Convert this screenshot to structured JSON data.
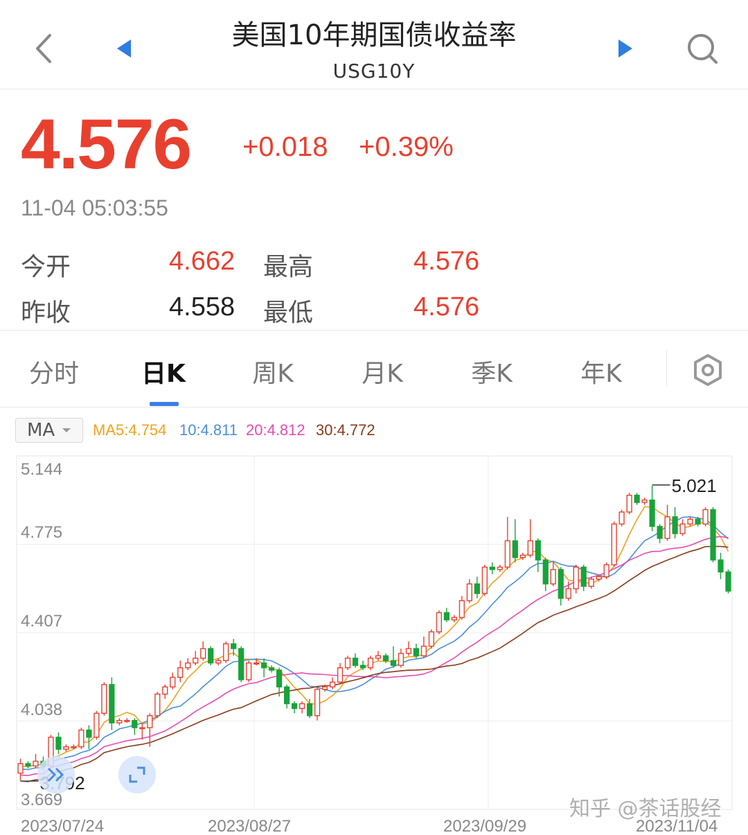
{
  "header": {
    "title": "美国10年期国债收益率",
    "symbol": "USG10Y"
  },
  "quote": {
    "price": "4.576",
    "change": "+0.018",
    "change_pct": "+0.39%",
    "timestamp": "11-04 05:03:55",
    "open_label": "今开",
    "open_value": "4.662",
    "high_label": "最高",
    "high_value": "4.576",
    "prev_close_label": "昨收",
    "prev_close_value": "4.558",
    "low_label": "最低",
    "low_value": "4.576"
  },
  "tabs": [
    {
      "label": "分时",
      "active": false
    },
    {
      "label": "日K",
      "active": true
    },
    {
      "label": "周K",
      "active": false
    },
    {
      "label": "月K",
      "active": false
    },
    {
      "label": "季K",
      "active": false
    },
    {
      "label": "年K",
      "active": false
    }
  ],
  "indicator": {
    "select_label": "MA",
    "ma5": "MA5:4.754",
    "ma10": "10:4.811",
    "ma20": "20:4.812",
    "ma30": "30:4.772"
  },
  "colors": {
    "up": "#e8402f",
    "down": "#19a33a",
    "ma5": "#f0a21c",
    "ma10": "#4a8fd8",
    "ma20": "#e64bb3",
    "ma30": "#8a3a1a"
  },
  "icons": {
    "back": "chevron-left-icon",
    "prev": "triangle-left-icon",
    "next": "triangle-right-icon",
    "search": "search-icon",
    "settings": "hexagon-settings-icon",
    "expand_left": "double-chevron-icon",
    "fullscreen": "fullscreen-icon"
  },
  "watermark": "知乎 @茶话股经",
  "chart_data": {
    "type": "candlestick",
    "y_ticks": [
      "5.144",
      "4.775",
      "4.407",
      "4.038",
      "3.669"
    ],
    "ylim": [
      3.669,
      5.144
    ],
    "x_labels": [
      "2023/07/24",
      "2023/08/27",
      "2023/09/29",
      "2023/11/04"
    ],
    "max_label": "5.021",
    "min_label": "3.792",
    "grid": true,
    "candles": [
      [
        3.82,
        3.86,
        3.79,
        3.88
      ],
      [
        3.86,
        3.85,
        3.84,
        3.87
      ],
      [
        3.85,
        3.87,
        3.84,
        3.9
      ],
      [
        3.87,
        3.85,
        3.83,
        3.89
      ],
      [
        3.85,
        3.97,
        3.84,
        3.98
      ],
      [
        3.97,
        3.92,
        3.9,
        3.99
      ],
      [
        3.92,
        3.93,
        3.91,
        3.94
      ],
      [
        3.93,
        3.93,
        3.92,
        3.94
      ],
      [
        3.93,
        4.0,
        3.92,
        4.01
      ],
      [
        4.0,
        3.97,
        3.92,
        4.02
      ],
      [
        3.97,
        4.07,
        3.96,
        4.08
      ],
      [
        4.07,
        4.19,
        4.06,
        4.2
      ],
      [
        4.19,
        4.03,
        4.0,
        4.22
      ],
      [
        4.03,
        4.04,
        4.02,
        4.05
      ],
      [
        4.04,
        4.04,
        4.03,
        4.05
      ],
      [
        4.04,
        4.01,
        3.98,
        4.05
      ],
      [
        4.01,
        4.01,
        3.96,
        4.03
      ],
      [
        4.01,
        4.06,
        3.93,
        4.07
      ],
      [
        4.06,
        4.15,
        4.05,
        4.16
      ],
      [
        4.15,
        4.18,
        4.13,
        4.19
      ],
      [
        4.18,
        4.22,
        4.17,
        4.24
      ],
      [
        4.22,
        4.26,
        4.2,
        4.29
      ],
      [
        4.26,
        4.28,
        4.25,
        4.3
      ],
      [
        4.28,
        4.3,
        4.27,
        4.33
      ],
      [
        4.3,
        4.34,
        4.29,
        4.37
      ],
      [
        4.34,
        4.28,
        4.27,
        4.35
      ],
      [
        4.28,
        4.29,
        4.27,
        4.3
      ],
      [
        4.29,
        4.36,
        4.28,
        4.37
      ],
      [
        4.36,
        4.34,
        4.31,
        4.38
      ],
      [
        4.34,
        4.21,
        4.2,
        4.35
      ],
      [
        4.21,
        4.28,
        4.2,
        4.29
      ],
      [
        4.28,
        4.28,
        4.27,
        4.3
      ],
      [
        4.28,
        4.26,
        4.22,
        4.3
      ],
      [
        4.26,
        4.25,
        4.24,
        4.27
      ],
      [
        4.25,
        4.18,
        4.14,
        4.26
      ],
      [
        4.18,
        4.11,
        4.09,
        4.19
      ],
      [
        4.11,
        4.09,
        4.07,
        4.12
      ],
      [
        4.09,
        4.11,
        4.07,
        4.12
      ],
      [
        4.11,
        4.06,
        4.05,
        4.13
      ],
      [
        4.06,
        4.17,
        4.04,
        4.18
      ],
      [
        4.17,
        4.18,
        4.16,
        4.19
      ],
      [
        4.18,
        4.2,
        4.17,
        4.22
      ],
      [
        4.2,
        4.26,
        4.19,
        4.28
      ],
      [
        4.26,
        4.3,
        4.25,
        4.31
      ],
      [
        4.3,
        4.27,
        4.26,
        4.32
      ],
      [
        4.27,
        4.26,
        4.25,
        4.29
      ],
      [
        4.26,
        4.3,
        4.25,
        4.31
      ],
      [
        4.3,
        4.31,
        4.29,
        4.33
      ],
      [
        4.31,
        4.29,
        4.28,
        4.32
      ],
      [
        4.29,
        4.27,
        4.26,
        4.35
      ],
      [
        4.27,
        4.32,
        4.26,
        4.34
      ],
      [
        4.32,
        4.34,
        4.31,
        4.37
      ],
      [
        4.34,
        4.31,
        4.3,
        4.36
      ],
      [
        4.31,
        4.35,
        4.3,
        4.39
      ],
      [
        4.35,
        4.41,
        4.34,
        4.42
      ],
      [
        4.41,
        4.49,
        4.4,
        4.5
      ],
      [
        4.49,
        4.46,
        4.45,
        4.51
      ],
      [
        4.46,
        4.47,
        4.45,
        4.48
      ],
      [
        4.47,
        4.54,
        4.46,
        4.56
      ],
      [
        4.54,
        4.61,
        4.53,
        4.63
      ],
      [
        4.61,
        4.57,
        4.55,
        4.64
      ],
      [
        4.57,
        4.68,
        4.56,
        4.69
      ],
      [
        4.68,
        4.67,
        4.65,
        4.7
      ],
      [
        4.67,
        4.68,
        4.66,
        4.69
      ],
      [
        4.68,
        4.79,
        4.67,
        4.89
      ],
      [
        4.79,
        4.72,
        4.7,
        4.88
      ],
      [
        4.72,
        4.73,
        4.71,
        4.74
      ],
      [
        4.73,
        4.79,
        4.72,
        4.88
      ],
      [
        4.79,
        4.71,
        4.66,
        4.8
      ],
      [
        4.71,
        4.61,
        4.58,
        4.72
      ],
      [
        4.61,
        4.67,
        4.6,
        4.7
      ],
      [
        4.67,
        4.55,
        4.52,
        4.68
      ],
      [
        4.55,
        4.59,
        4.54,
        4.62
      ],
      [
        4.59,
        4.68,
        4.57,
        4.69
      ],
      [
        4.68,
        4.6,
        4.58,
        4.69
      ],
      [
        4.6,
        4.63,
        4.59,
        4.64
      ],
      [
        4.63,
        4.64,
        4.62,
        4.65
      ],
      [
        4.64,
        4.69,
        4.63,
        4.7
      ],
      [
        4.69,
        4.86,
        4.68,
        4.87
      ],
      [
        4.86,
        4.91,
        4.85,
        4.92
      ],
      [
        4.91,
        4.98,
        4.9,
        4.99
      ],
      [
        4.98,
        4.95,
        4.94,
        4.99
      ],
      [
        4.95,
        4.96,
        4.94,
        4.97
      ],
      [
        4.96,
        4.85,
        4.83,
        5.02
      ],
      [
        4.85,
        4.8,
        4.78,
        4.86
      ],
      [
        4.8,
        4.89,
        4.79,
        4.94
      ],
      [
        4.89,
        4.82,
        4.8,
        4.93
      ],
      [
        4.82,
        4.86,
        4.81,
        4.88
      ],
      [
        4.86,
        4.88,
        4.85,
        4.89
      ],
      [
        4.88,
        4.86,
        4.85,
        4.89
      ],
      [
        4.86,
        4.92,
        4.85,
        4.93
      ],
      [
        4.92,
        4.71,
        4.7,
        4.93
      ],
      [
        4.71,
        4.66,
        4.63,
        4.74
      ],
      [
        4.66,
        4.58,
        4.57,
        4.67
      ]
    ]
  }
}
